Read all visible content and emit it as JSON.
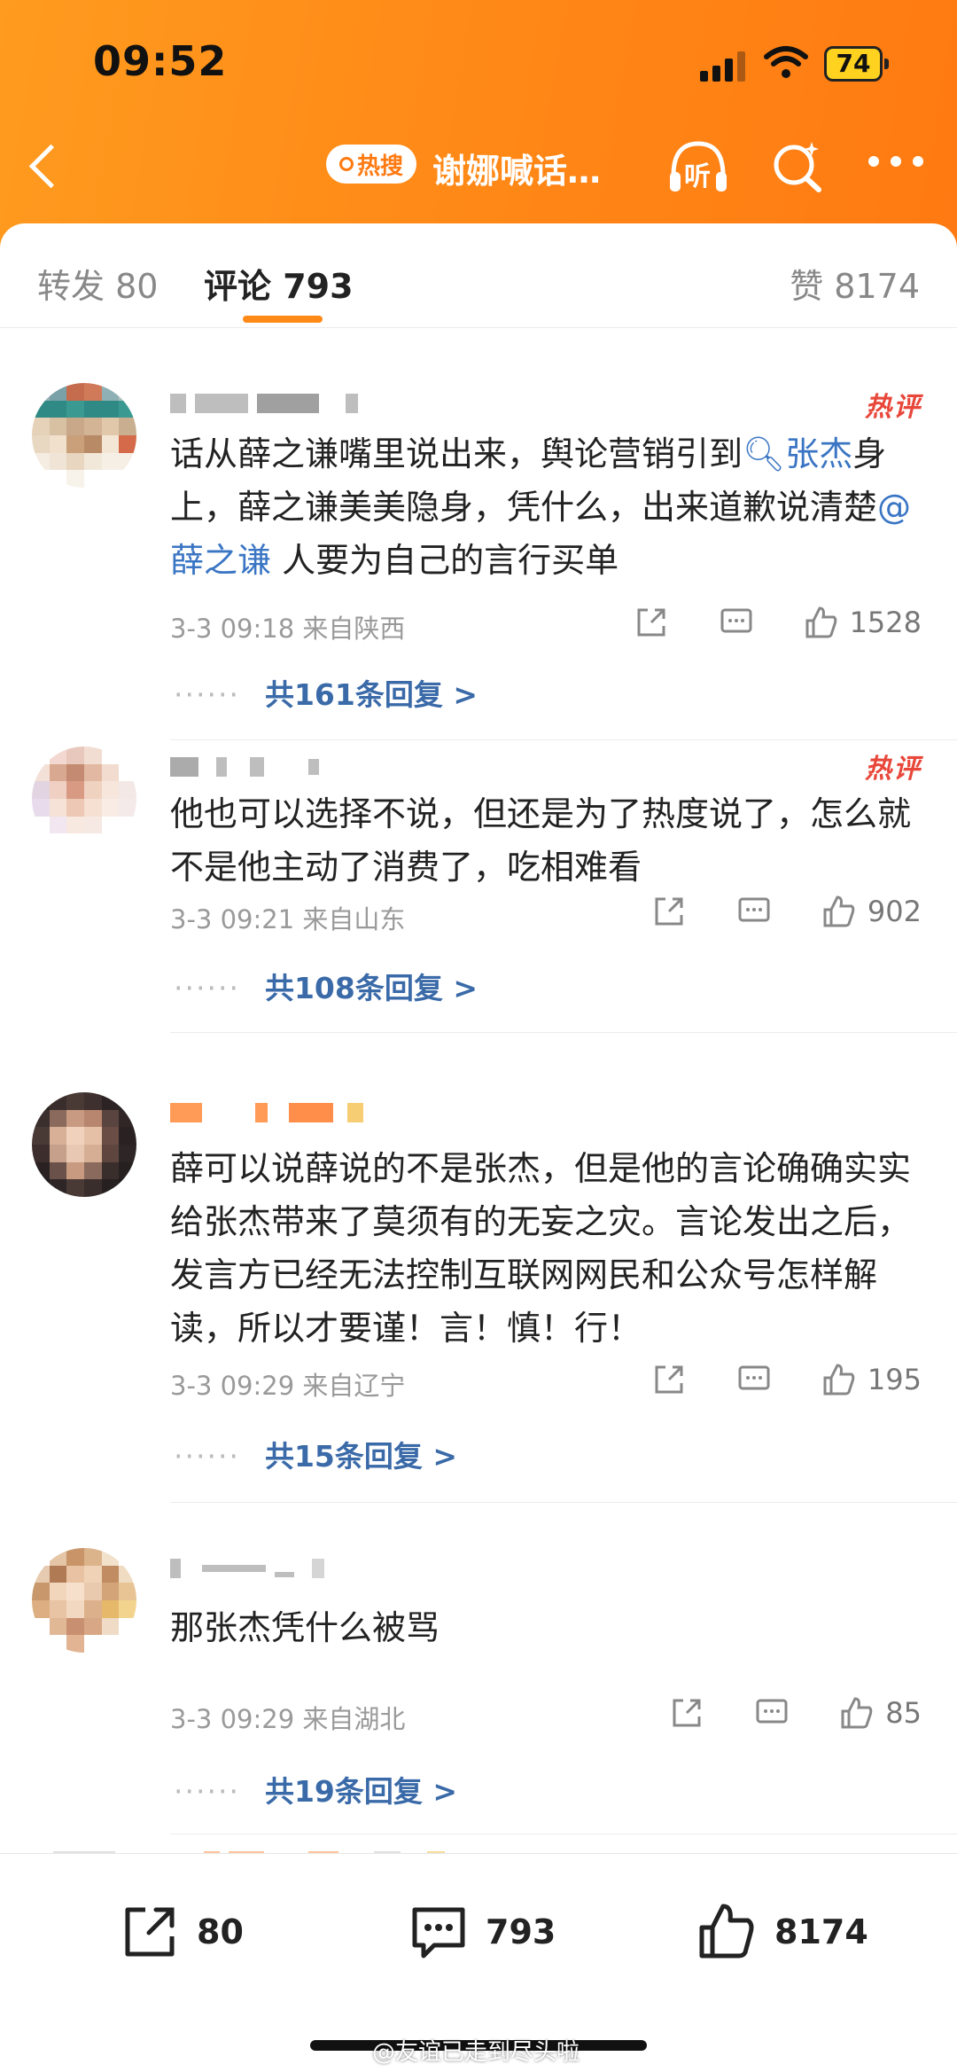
{
  "status_bar": {
    "time": "09:52",
    "battery": "74"
  },
  "nav": {
    "hot_pill": "热搜",
    "title": "谢娜喊话…",
    "listen_label": "听"
  },
  "tabs": {
    "repost": "转发 80",
    "comments": "评论 793",
    "likes": "赞 8174"
  },
  "comments": [
    {
      "badge": "热评",
      "text_parts": [
        "话从薛之谦嘴里说出来，舆论营销引到",
        "张杰",
        "身上，薛之谦美美隐身，凭什么，出来道歉说清楚",
        "@薛之谦",
        " 人要为自己的言行买单"
      ],
      "meta": "3-3 09:18  来自陕西",
      "likes": "1528",
      "replies": "共161条回复 >"
    },
    {
      "badge": "热评",
      "text": "他也可以选择不说，但还是为了热度说了，怎么就不是他主动了消费了，吃相难看",
      "meta": "3-3 09:21  来自山东",
      "likes": "902",
      "replies": "共108条回复 >"
    },
    {
      "text": "薛可以说薛说的不是张杰，但是他的言论确确实实给张杰带来了莫须有的无妄之灾。言论发出之后，发言方已经无法控制互联网网民和公众号怎样解读，所以才要谨！言！慎！行！",
      "meta": "3-3 09:29  来自辽宁",
      "likes": "195",
      "replies": "共15条回复 >"
    },
    {
      "text": "那张杰凭什么被骂",
      "meta": "3-3 09:29  来自湖北",
      "likes": "85",
      "replies": "共19条回复 >"
    }
  ],
  "bottom_bar": {
    "repost": "80",
    "comment": "793",
    "like": "8174"
  },
  "watermark": "@友谊已走到尽头啦",
  "colors": {
    "accent": "#ff8a17",
    "link": "#3a75c4",
    "hot": "#e8473a"
  },
  "icons": [
    "back-icon",
    "search-icon",
    "headphones-icon",
    "more-icon",
    "repost-icon",
    "comment-icon",
    "like-icon"
  ]
}
